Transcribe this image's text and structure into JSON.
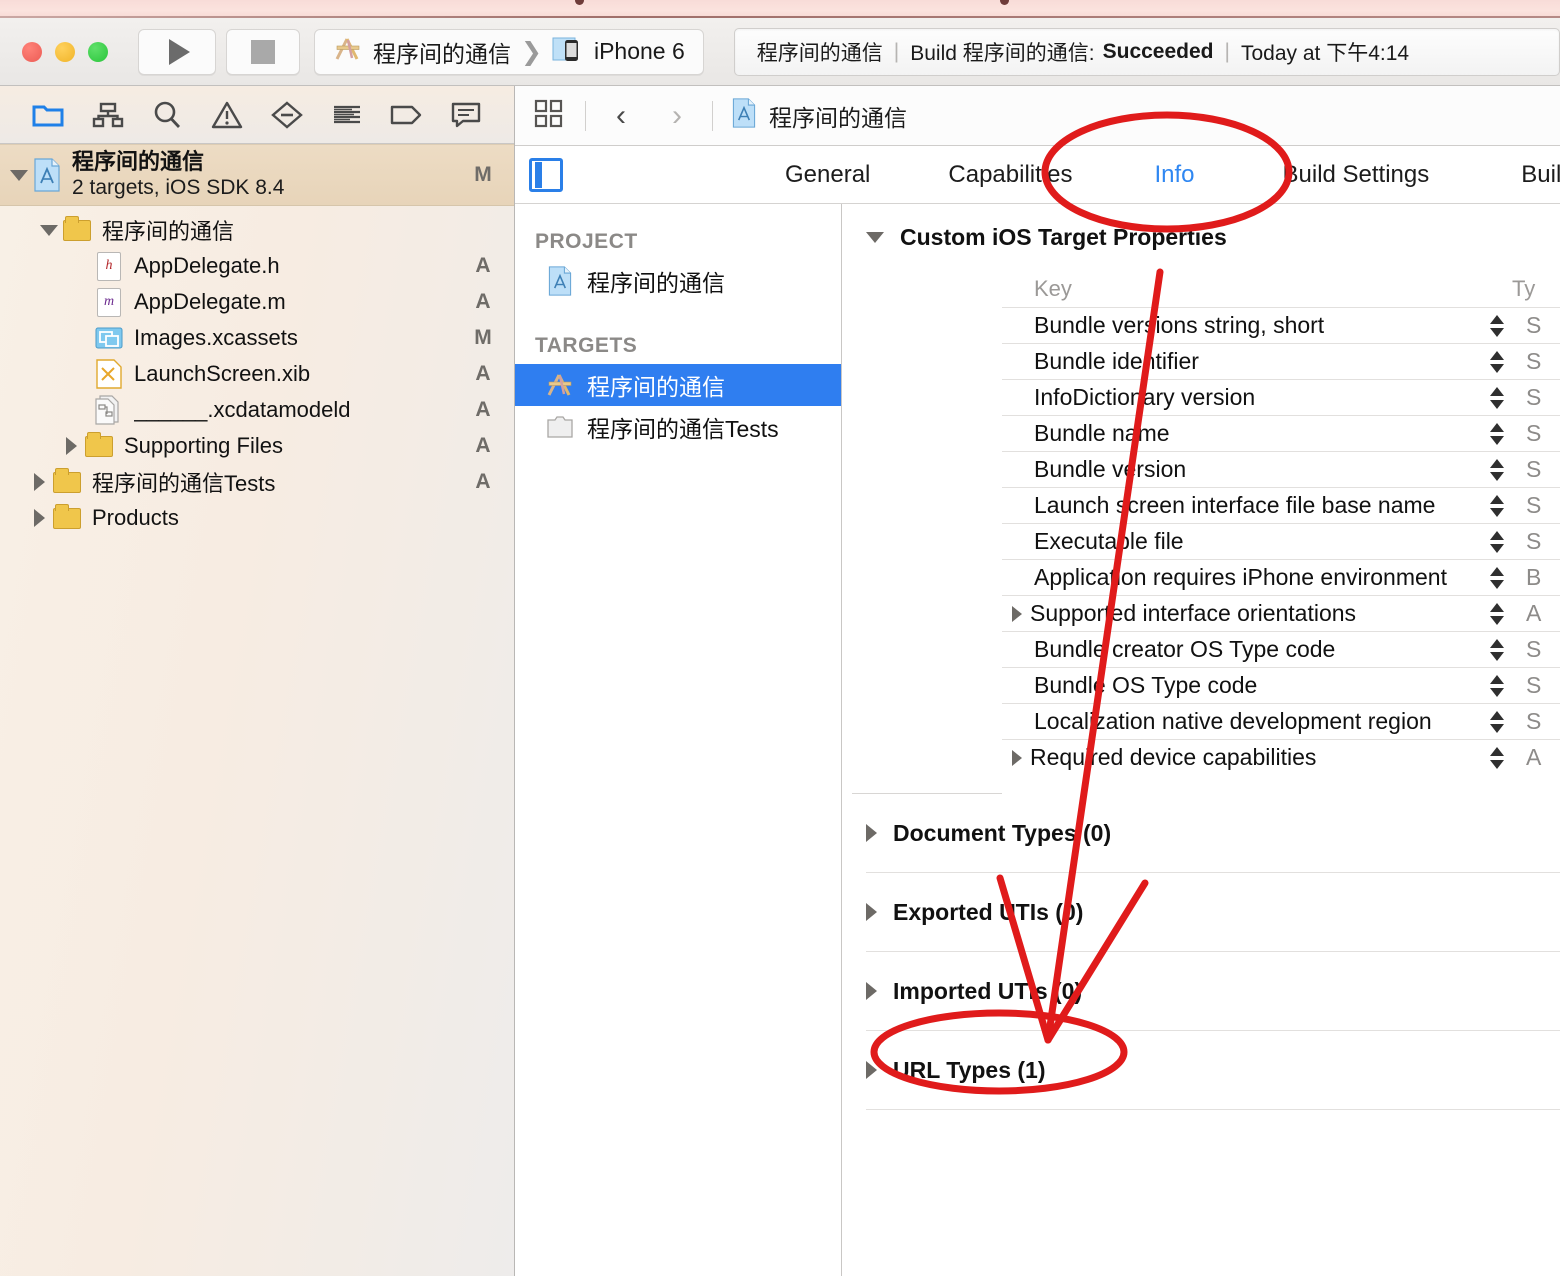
{
  "window": {
    "title": "程序间的通信",
    "traffic_lights": [
      "close",
      "minimize",
      "zoom"
    ]
  },
  "toolbar": {
    "run_button": "run-button",
    "stop_button": "stop-button",
    "scheme": {
      "project_name": "程序间的通信",
      "chevron": "❯",
      "device": "iPhone 6"
    },
    "status": {
      "project": "程序间的通信",
      "sep1": "|",
      "build_prefix": "Build 程序间的通信:",
      "build_result": "Succeeded",
      "sep2": "|",
      "time": "Today at 下午4:14"
    }
  },
  "navigator": {
    "toolbar_icons": [
      {
        "name": "folder-icon",
        "label": "Project navigator",
        "active": true
      },
      {
        "name": "hierarchy-icon",
        "label": "Symbol navigator",
        "active": false
      },
      {
        "name": "search-icon",
        "label": "Find navigator",
        "active": false
      },
      {
        "name": "warning-icon",
        "label": "Issue navigator",
        "active": false
      },
      {
        "name": "test-icon",
        "label": "Test navigator",
        "active": false
      },
      {
        "name": "debug-icon",
        "label": "Debug navigator",
        "active": false
      },
      {
        "name": "breakpoint-icon",
        "label": "Breakpoint navigator",
        "active": false
      },
      {
        "name": "report-icon",
        "label": "Report navigator",
        "active": false
      }
    ],
    "project_row": {
      "title": "程序间的通信",
      "subtitle": "2 targets, iOS SDK 8.4",
      "status": "M"
    },
    "items": [
      {
        "label": "程序间的通信",
        "icon": "folder-icon",
        "status": "",
        "indent": 1,
        "disclosure": "open"
      },
      {
        "label": "AppDelegate.h",
        "icon": "header-file-icon",
        "status": "A",
        "indent": 2,
        "disclosure": "none"
      },
      {
        "label": "AppDelegate.m",
        "icon": "source-file-icon",
        "status": "A",
        "indent": 2,
        "disclosure": "none"
      },
      {
        "label": "Images.xcassets",
        "icon": "assets-icon",
        "status": "M",
        "indent": 2,
        "disclosure": "none"
      },
      {
        "label": "LaunchScreen.xib",
        "icon": "xib-icon",
        "status": "A",
        "indent": 2,
        "disclosure": "none"
      },
      {
        "label": "______.xcdatamodeld",
        "icon": "datamodel-icon",
        "status": "A",
        "indent": 2,
        "disclosure": "none"
      },
      {
        "label": "Supporting Files",
        "icon": "folder-icon",
        "status": "A",
        "indent": 2,
        "disclosure": "closed"
      },
      {
        "label": "程序间的通信Tests",
        "icon": "folder-icon",
        "status": "A",
        "indent": 1,
        "disclosure": "closed"
      },
      {
        "label": "Products",
        "icon": "folder-icon",
        "status": "",
        "indent": 1,
        "disclosure": "closed"
      }
    ]
  },
  "jumpbar": {
    "related_items_icon": "related-items-icon",
    "back": "‹",
    "forward": "›",
    "breadcrumb": "程序间的通信"
  },
  "tabs": {
    "editor_toggle_icon": "editor-panel-icon",
    "items": [
      {
        "label": "General",
        "selected": false
      },
      {
        "label": "Capabilities",
        "selected": false
      },
      {
        "label": "Info",
        "selected": true
      },
      {
        "label": "Build Settings",
        "selected": false
      },
      {
        "label": "Build P",
        "selected": false
      }
    ]
  },
  "targets_pane": {
    "project_header": "PROJECT",
    "project_items": [
      {
        "label": "程序间的通信",
        "icon": "project-icon",
        "selected": false
      }
    ],
    "targets_header": "TARGETS",
    "target_items": [
      {
        "label": "程序间的通信",
        "icon": "app-target-icon",
        "selected": true
      },
      {
        "label": "程序间的通信Tests",
        "icon": "test-target-icon",
        "selected": false
      }
    ]
  },
  "info_pane": {
    "section_title": "Custom iOS Target Properties",
    "columns": {
      "key": "Key",
      "type": "Ty"
    },
    "rows": [
      {
        "key": "Bundle versions string, short",
        "type": "S",
        "expandable": false
      },
      {
        "key": "Bundle identifier",
        "type": "S",
        "expandable": false
      },
      {
        "key": "InfoDictionary version",
        "type": "S",
        "expandable": false
      },
      {
        "key": "Bundle name",
        "type": "S",
        "expandable": false
      },
      {
        "key": "Bundle version",
        "type": "S",
        "expandable": false
      },
      {
        "key": "Launch screen interface file base name",
        "type": "S",
        "expandable": false
      },
      {
        "key": "Executable file",
        "type": "S",
        "expandable": false
      },
      {
        "key": "Application requires iPhone environment",
        "type": "B",
        "expandable": false
      },
      {
        "key": "Supported interface orientations",
        "type": "A",
        "expandable": true
      },
      {
        "key": "Bundle creator OS Type code",
        "type": "S",
        "expandable": false
      },
      {
        "key": "Bundle OS Type code",
        "type": "S",
        "expandable": false
      },
      {
        "key": "Localization native development region",
        "type": "S",
        "expandable": false
      },
      {
        "key": "Required device capabilities",
        "type": "A",
        "expandable": true
      }
    ],
    "collapsed_sections": [
      {
        "label": "Document Types (0)"
      },
      {
        "label": "Exported UTIs (0)"
      },
      {
        "label": "Imported UTIs (0)"
      },
      {
        "label": "URL Types (1)"
      }
    ]
  },
  "annotations": {
    "color": "#e01b1b",
    "shapes": [
      {
        "name": "ellipse-info-tab",
        "kind": "ellipse"
      },
      {
        "name": "ellipse-url-types",
        "kind": "ellipse"
      },
      {
        "name": "arrow-info-to-url-types",
        "kind": "arrow"
      },
      {
        "name": "arrow-left-branch",
        "kind": "line"
      },
      {
        "name": "arrow-right-branch",
        "kind": "line"
      }
    ]
  }
}
